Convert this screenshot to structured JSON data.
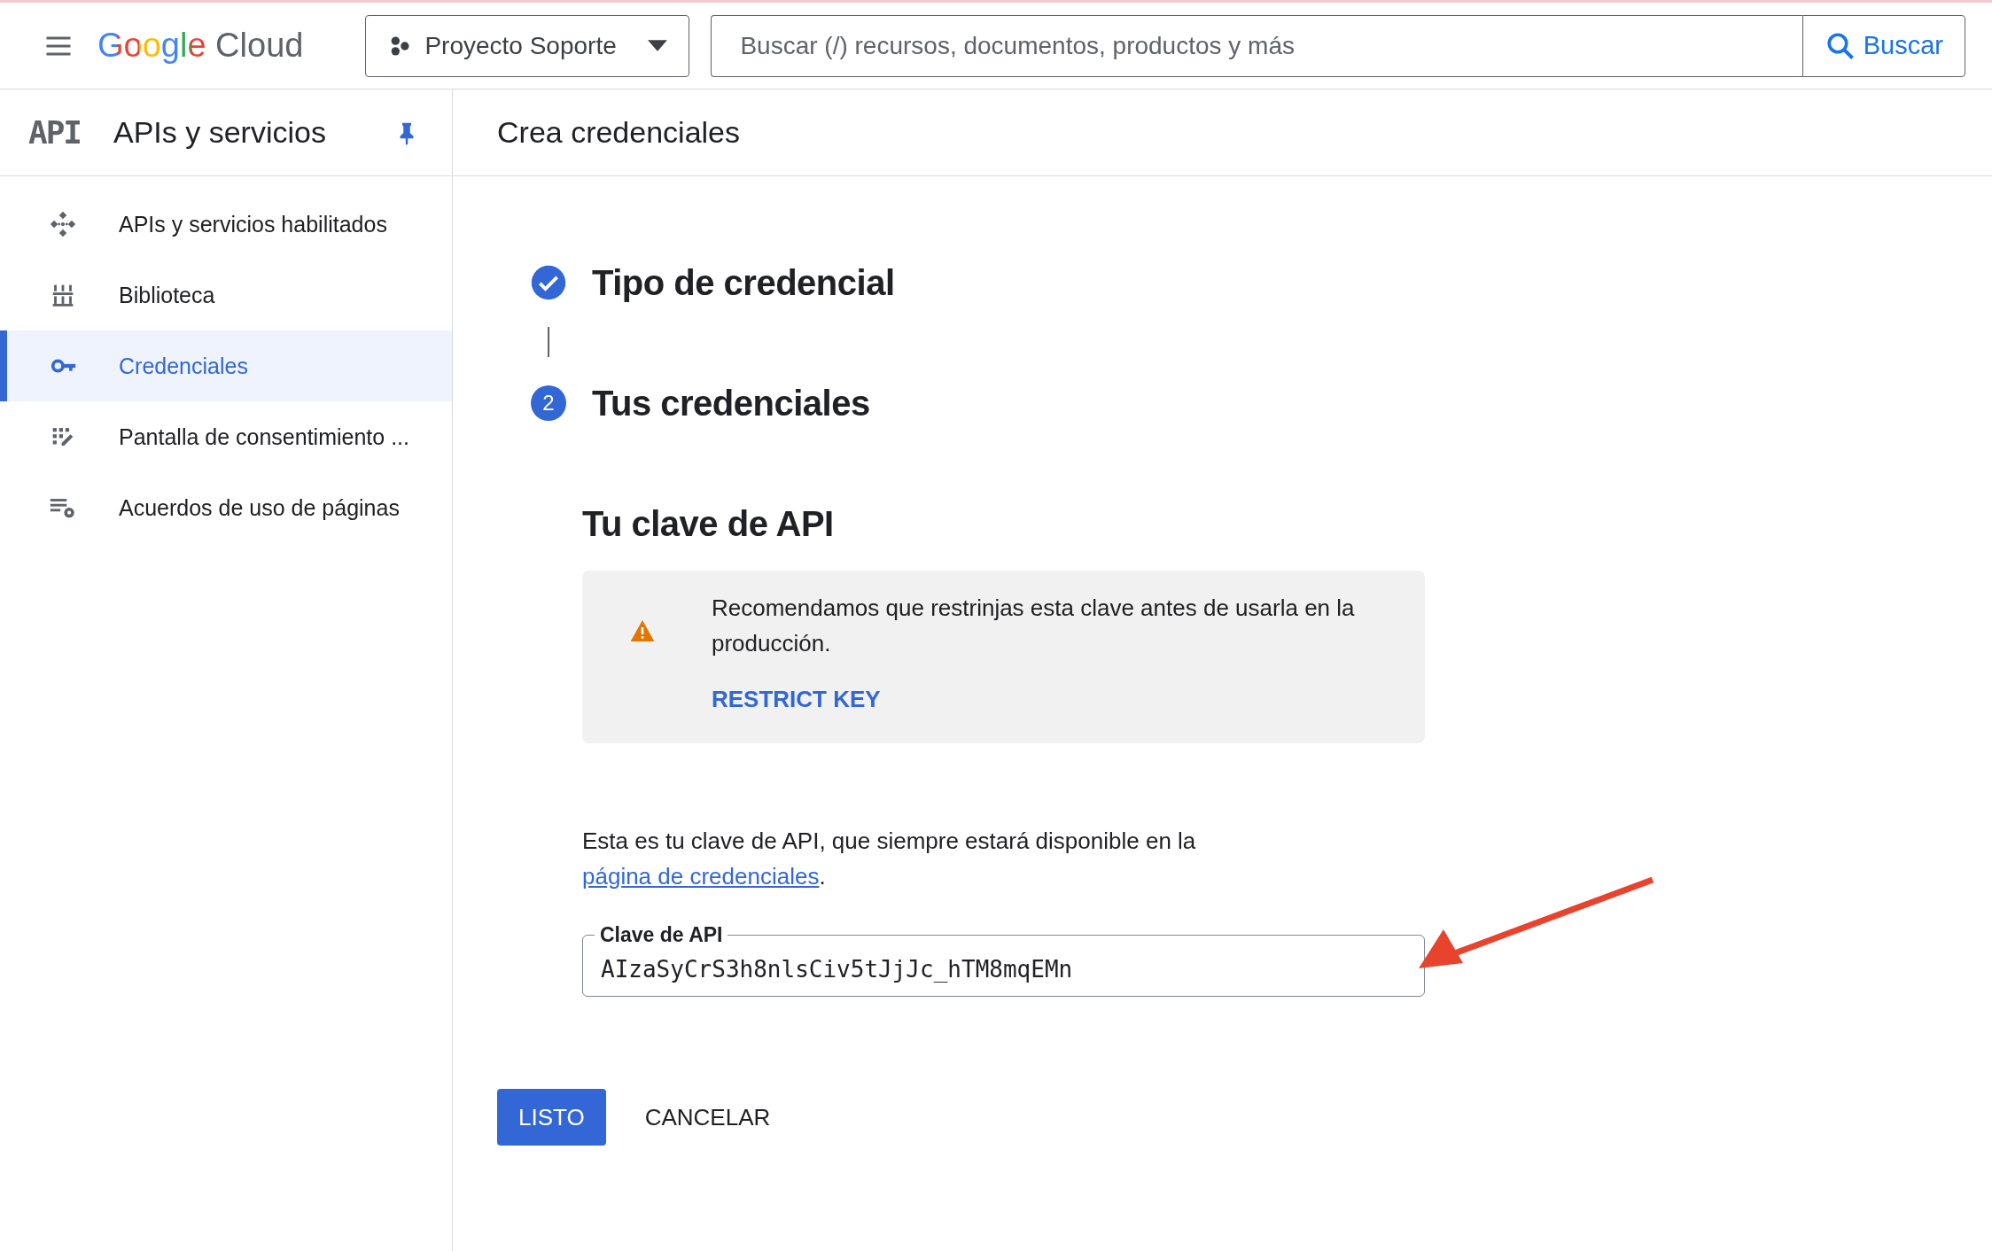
{
  "topbar": {
    "logo": {
      "brand": "Google",
      "product": "Cloud"
    },
    "project": "Proyecto Soporte",
    "search": {
      "placeholder": "Buscar (/) recursos, documentos, productos y más",
      "button": "Buscar"
    }
  },
  "sidebar": {
    "badge": "API",
    "title": "APIs y servicios",
    "items": [
      {
        "label": "APIs y servicios habilitados",
        "kind": "apis",
        "selected": false
      },
      {
        "label": "Biblioteca",
        "kind": "library",
        "selected": false
      },
      {
        "label": "Credenciales",
        "kind": "key",
        "selected": true
      },
      {
        "label": "Pantalla de consentimiento ...",
        "kind": "consent",
        "selected": false
      },
      {
        "label": "Acuerdos de uso de páginas",
        "kind": "settings",
        "selected": false
      }
    ]
  },
  "page": {
    "title": "Crea credenciales",
    "steps": [
      {
        "kind": "done",
        "label": "Tipo de credencial"
      },
      {
        "kind": "number",
        "number": "2",
        "label": "Tus credenciales"
      }
    ],
    "section_title": "Tu clave de API",
    "warning": {
      "text": "Recomendamos que restrinjas esta clave antes de usarla en la producción.",
      "action": "RESTRICT KEY"
    },
    "info": {
      "text": "Esta es tu clave de API, que siempre estará disponible en la ",
      "link": "página de credenciales",
      "after": "."
    },
    "key_field": {
      "label": "Clave de API",
      "value": "AIzaSyCrS3h8nlsCiv5tJjJc_hTM8mqEMn"
    },
    "buttons": [
      {
        "label": "LISTO",
        "kind": "primary"
      },
      {
        "label": "CANCELAR",
        "kind": "text"
      }
    ]
  }
}
